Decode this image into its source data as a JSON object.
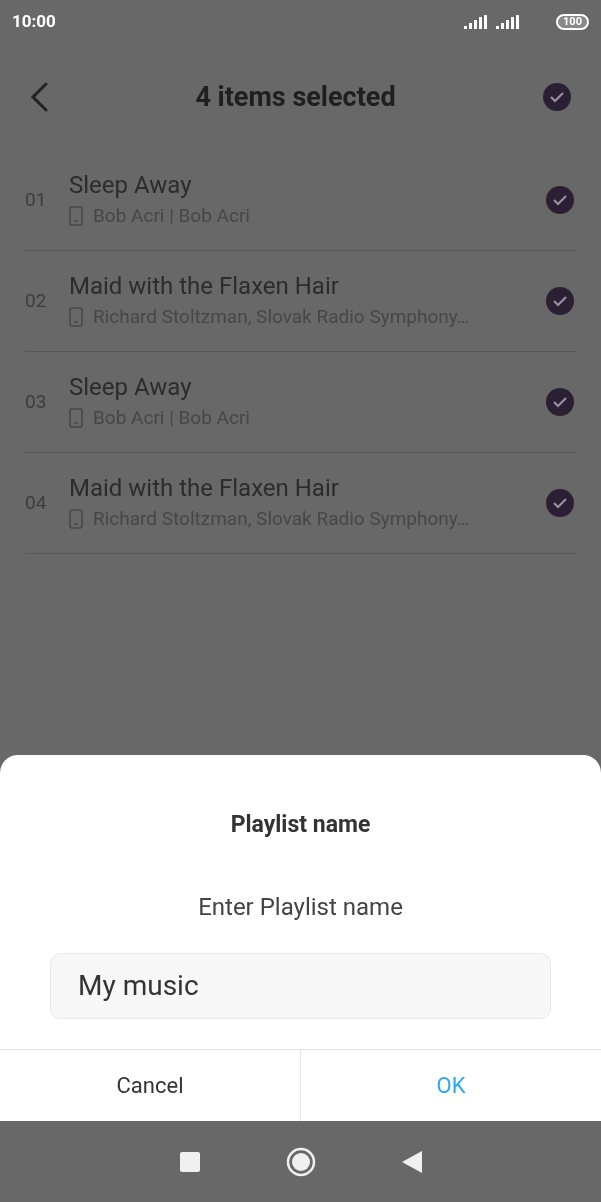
{
  "status_bar": {
    "time": "10:00",
    "battery": "100"
  },
  "header": {
    "title": "4 items selected",
    "select_all": {
      "checked": true
    }
  },
  "songs": [
    {
      "number": "01",
      "title": "Sleep Away",
      "artist": "Bob Acri | Bob Acri",
      "checked": true
    },
    {
      "number": "02",
      "title": "Maid with the Flaxen Hair",
      "artist": "Richard Stoltzman, Slovak Radio Symphony…",
      "checked": true
    },
    {
      "number": "03",
      "title": "Sleep Away",
      "artist": "Bob Acri | Bob Acri",
      "checked": true
    },
    {
      "number": "04",
      "title": "Maid with the Flaxen Hair",
      "artist": "Richard Stoltzman, Slovak Radio Symphony…",
      "checked": true
    }
  ],
  "dialog": {
    "title": "Playlist name",
    "message": "Enter Playlist name",
    "field": {
      "value": "My music"
    },
    "buttons": [
      {
        "label": "Cancel",
        "kind": "neutral"
      },
      {
        "label": "OK",
        "kind": "primary"
      }
    ]
  }
}
